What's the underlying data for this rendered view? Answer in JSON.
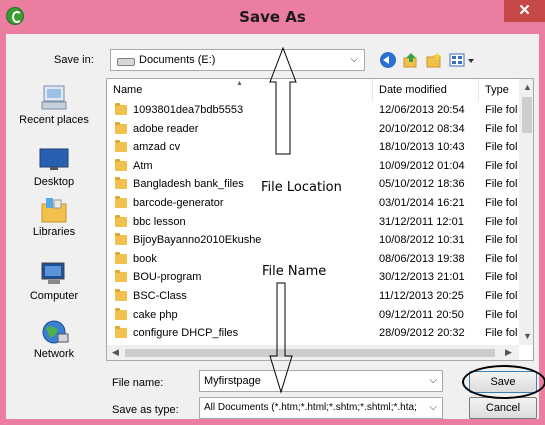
{
  "window": {
    "title": "Save As",
    "close_glyph": "✕"
  },
  "toolbar": {
    "save_in_label": "Save in:",
    "save_in_value": "Documents (E:)",
    "icons": [
      "back-icon",
      "up-folder-icon",
      "new-folder-icon",
      "views-menu-icon"
    ]
  },
  "places": [
    {
      "label": "Recent places",
      "icon": "recent-places-icon"
    },
    {
      "label": "Desktop",
      "icon": "desktop-icon"
    },
    {
      "label": "Libraries",
      "icon": "libraries-icon"
    },
    {
      "label": "Computer",
      "icon": "computer-icon"
    },
    {
      "label": "Network",
      "icon": "network-icon"
    }
  ],
  "columns": {
    "name": "Name",
    "date": "Date modified",
    "type": "Type"
  },
  "files": [
    {
      "name": "1093801dea7bdb5553",
      "date": "12/06/2013 20:54",
      "type": "File fol"
    },
    {
      "name": "adobe reader",
      "date": "20/10/2012 08:34",
      "type": "File fol"
    },
    {
      "name": "amzad cv",
      "date": "18/10/2013 10:43",
      "type": "File fol"
    },
    {
      "name": "Atm",
      "date": "10/09/2012 01:04",
      "type": "File fol"
    },
    {
      "name": "Bangladesh bank_files",
      "date": "05/10/2012 18:36",
      "type": "File fol"
    },
    {
      "name": "barcode-generator",
      "date": "03/01/2014 16:21",
      "type": "File fol"
    },
    {
      "name": "bbc lesson",
      "date": "31/12/2011 12:01",
      "type": "File fol"
    },
    {
      "name": "BijoyBayanno2010Ekushe",
      "date": "10/08/2012 10:31",
      "type": "File fol"
    },
    {
      "name": "book",
      "date": "08/06/2013 19:38",
      "type": "File fol"
    },
    {
      "name": "BOU-program",
      "date": "30/12/2013 21:01",
      "type": "File fol"
    },
    {
      "name": "BSC-Class",
      "date": "11/12/2013 20:25",
      "type": "File fol"
    },
    {
      "name": "cake php",
      "date": "09/12/2011 20:50",
      "type": "File fol"
    },
    {
      "name": "configure DHCP_files",
      "date": "28/09/2012 20:32",
      "type": "File fol"
    }
  ],
  "form": {
    "file_name_label": "File name:",
    "file_name_value": "Myfirstpage",
    "save_type_label": "Save as type:",
    "save_type_value": "All Documents (*.htm;*.html;*.shtm;*.shtml;*.hta;"
  },
  "buttons": {
    "save": "Save",
    "cancel": "Cancel"
  },
  "annotations": {
    "file_location": "File Location",
    "file_name": "File Name"
  },
  "colors": {
    "titlebar": "#eb7ea0",
    "close": "#c74848",
    "folder": "#f2c04d"
  }
}
